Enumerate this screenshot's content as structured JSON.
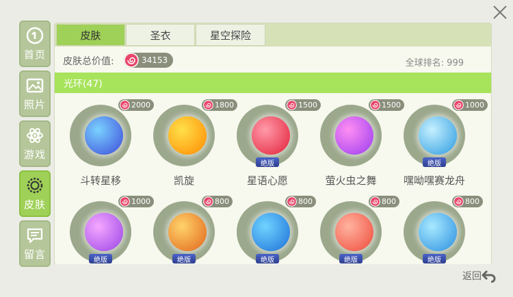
{
  "sidebar": {
    "items": [
      {
        "label": "首页",
        "icon": "home-icon"
      },
      {
        "label": "照片",
        "icon": "photo-icon"
      },
      {
        "label": "游戏",
        "icon": "atom-icon"
      },
      {
        "label": "皮肤",
        "icon": "ring-icon",
        "active": true
      },
      {
        "label": "留言",
        "icon": "message-icon"
      }
    ]
  },
  "tabs": [
    "皮肤",
    "圣衣",
    "星空探险"
  ],
  "info": {
    "label": "皮肤总价值:",
    "total": "34153",
    "rank": "全球排名: 999"
  },
  "category": "光环(47)",
  "badge_text": "绝版",
  "items": [
    {
      "name": "斗转星移",
      "price": "2000",
      "limited": false,
      "colors": [
        "#7ad2ff",
        "#3d4ad9"
      ]
    },
    {
      "name": "凯旋",
      "price": "1800",
      "limited": false,
      "colors": [
        "#ffe04a",
        "#ff8a00"
      ]
    },
    {
      "name": "星语心愿",
      "price": "1500",
      "limited": true,
      "colors": [
        "#ff9aa8",
        "#e3203a"
      ]
    },
    {
      "name": "萤火虫之舞",
      "price": "1500",
      "limited": false,
      "colors": [
        "#ff8ef2",
        "#9a3cf0"
      ]
    },
    {
      "name": "嘿呦嘿赛龙舟",
      "price": "1000",
      "limited": true,
      "colors": [
        "#c6f0ff",
        "#2b9be0"
      ]
    },
    {
      "name": "",
      "price": "1000",
      "limited": true,
      "colors": [
        "#f5a8ff",
        "#9a44e6"
      ]
    },
    {
      "name": "",
      "price": "800",
      "limited": true,
      "colors": [
        "#ffd36b",
        "#e1651b"
      ]
    },
    {
      "name": "",
      "price": "800",
      "limited": true,
      "colors": [
        "#6fd4ff",
        "#1e6fd8"
      ]
    },
    {
      "name": "",
      "price": "800",
      "limited": true,
      "colors": [
        "#ffb3a0",
        "#ef4a3a"
      ]
    },
    {
      "name": "",
      "price": "800",
      "limited": true,
      "colors": [
        "#a8e9ff",
        "#2a8fe0"
      ]
    }
  ],
  "back_label": "返回"
}
